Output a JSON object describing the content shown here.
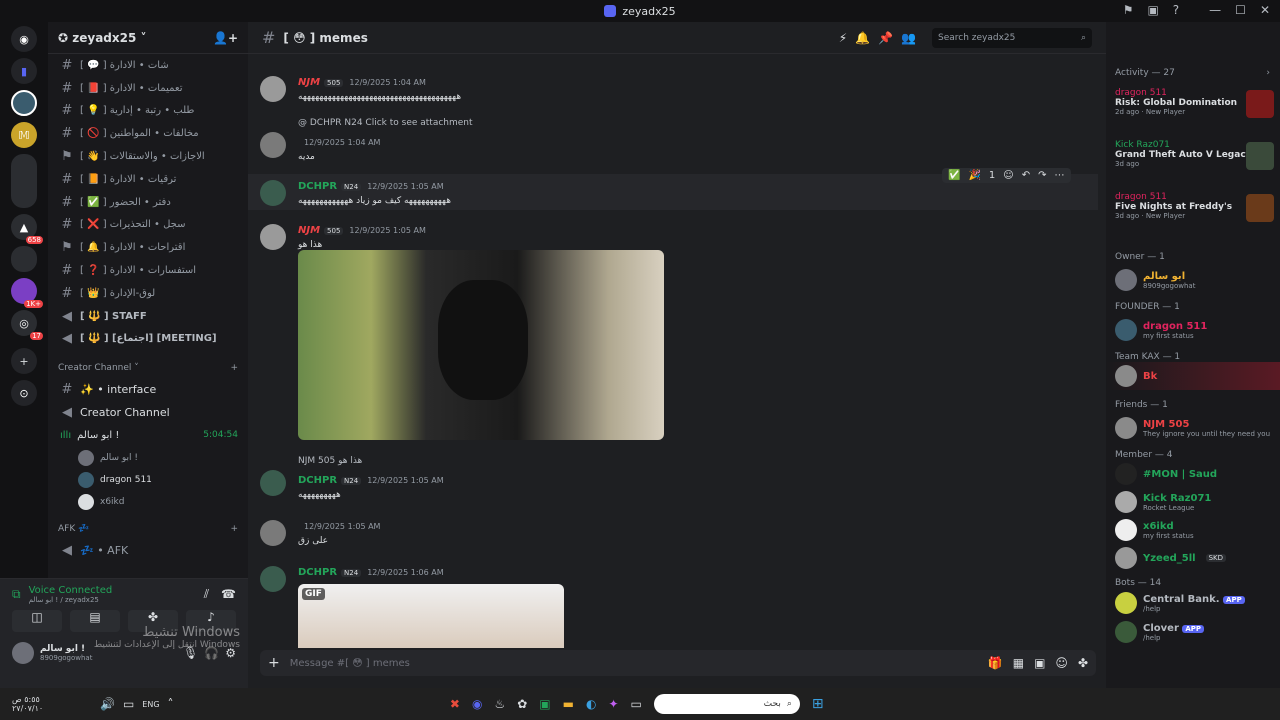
{
  "window": {
    "title": "zeyadx25",
    "brand": "#5865f2"
  },
  "server": {
    "name": "zeyadx25"
  },
  "channels": [
    {
      "label": "[ 💬 ] شات • الادارة"
    },
    {
      "label": "[ 📕 ] تعميمات • الادارة"
    },
    {
      "label": "[ 💡 ] طلب • رتبة • إدارية"
    },
    {
      "label": "[ 🚫 ] مخالفات • المواطنين"
    },
    {
      "label": "[ 👋 ] الاجازات • والاستقالات"
    },
    {
      "label": "[ 📙 ] ترقيات • الادارة"
    },
    {
      "label": "[ ✅ ] دفتر • الحضور"
    },
    {
      "label": "[ ❌ ] سجل • التحذيرات"
    },
    {
      "label": "[ 🔔 ] اقتراحات • الادارة"
    },
    {
      "label": "[ ❓ ] استفسارات • الادارة"
    },
    {
      "label": "[ 👑 ] لوق-الإدارة"
    },
    {
      "label": "[ 🔱 ] STAFF"
    },
    {
      "label": "[ 🔱 ] [اجتماع] [MEETING]"
    }
  ],
  "creator": {
    "category": "Creator Channel",
    "text_channel": "✨ • interface",
    "voice_channel": "Creator Channel"
  },
  "voice_room": {
    "name": "ابو سالم !",
    "timer": "5:04:54",
    "users": [
      "ابو سالم !",
      "dragon 511",
      "x6ikd"
    ]
  },
  "afk": {
    "category": "AFK 💤",
    "channel": "💤 • AFK"
  },
  "voice_panel": {
    "status": "Voice Connected",
    "sub": "ابو سالم ! / zeyadx25",
    "user_name": "ابو سالم !",
    "user_status": "8909gogowhat"
  },
  "activation": {
    "line1": "تنشيط Windows",
    "line2": "انتقل إلى الإعدادات لتنشيط Windows"
  },
  "channel_header": {
    "icon": "hash-icon",
    "name": "[ 😳 ] memes",
    "search_placeholder": "Search zeyadx25"
  },
  "messages": [
    {
      "author": "NJM",
      "tag": "505",
      "time": "12/9/2025 1:04 AM",
      "text": "ههههههههههههههههههههههههههههههههههههههه"
    },
    {
      "reply": "@ DCHPR N24  Click to see attachment",
      "author": "",
      "time": "12/9/2025 1:04 AM",
      "text": "مديه"
    },
    {
      "author": "DCHPR",
      "tag": "N24",
      "time": "12/9/2025 1:05 AM",
      "text": "ههههههههههه كيف مو زياد ههههههههههههه"
    },
    {
      "author": "NJM",
      "tag": "505",
      "time": "12/9/2025 1:05 AM",
      "text": "هذا هو"
    },
    {
      "reply": "NJM 505 هذا هو",
      "author": "DCHPR",
      "tag": "N24",
      "time": "12/9/2025 1:05 AM",
      "text": "هههههههههه"
    },
    {
      "author": "",
      "time": "12/9/2025 1:05 AM",
      "text": "على زق"
    },
    {
      "author": "DCHPR",
      "tag": "N24",
      "time": "12/9/2025 1:06 AM",
      "text": "GIF"
    }
  ],
  "composer": {
    "placeholder": "Message #[ 😳 ] memes"
  },
  "members": {
    "activity_title": "Activity — 27",
    "activities": [
      {
        "user": "dragon 511",
        "game": "Risk: Global Domination",
        "meta": "2d ago",
        "extra": "New Player",
        "icon": "risk-icon",
        "color": "#e0245e"
      },
      {
        "user": "Kick Raz071",
        "game": "Grand Theft Auto V Legacy",
        "meta": "3d ago",
        "extra": "",
        "icon": "gta-icon",
        "color": "#23a55a"
      },
      {
        "user": "dragon 511",
        "game": "Five Nights at Freddy's",
        "meta": "3d ago",
        "extra": "New Player",
        "icon": "fnaf-icon",
        "color": "#e0245e"
      }
    ],
    "groups": [
      {
        "title": "Owner — 1",
        "members": [
          {
            "name": "ابو سالم",
            "status": "8909gogowhat",
            "color": "#f0b232"
          }
        ]
      },
      {
        "title": "FOUNDER — 1",
        "members": [
          {
            "name": "dragon 511",
            "status": "my first status",
            "color": "#e0245e"
          }
        ]
      },
      {
        "title": "Team KAX — 1",
        "members": [
          {
            "name": "Bk",
            "status": "",
            "color": "#ed4245"
          }
        ]
      },
      {
        "title": "Friends — 1",
        "members": [
          {
            "name": "NJM 505",
            "status": "They ignore you until they need you",
            "color": "#ed4245"
          }
        ]
      },
      {
        "title": "Member — 4",
        "members": [
          {
            "name": "#MON | Saud",
            "status": "",
            "color": "#23a55a"
          },
          {
            "name": "Kick Raz071",
            "status": "Rocket League",
            "color": "#23a55a"
          },
          {
            "name": "x6ikd",
            "status": "my first status",
            "color": "#23a55a"
          },
          {
            "name": "Yzeed_5ll",
            "status": "SKD",
            "color": "#23a55a"
          }
        ]
      },
      {
        "title": "Bots — 14",
        "members": [
          {
            "name": "Central Bank.",
            "status": "/help",
            "color": "#b5bac1",
            "badge": "APP"
          },
          {
            "name": "Clover",
            "status": "/help",
            "color": "#b5bac1",
            "badge": "APP"
          }
        ]
      }
    ]
  },
  "taskbar": {
    "time": "٥:٥٥ ص",
    "date": "٢٧/٠٧/١٠",
    "lang": "ENG",
    "search": "بحث"
  }
}
